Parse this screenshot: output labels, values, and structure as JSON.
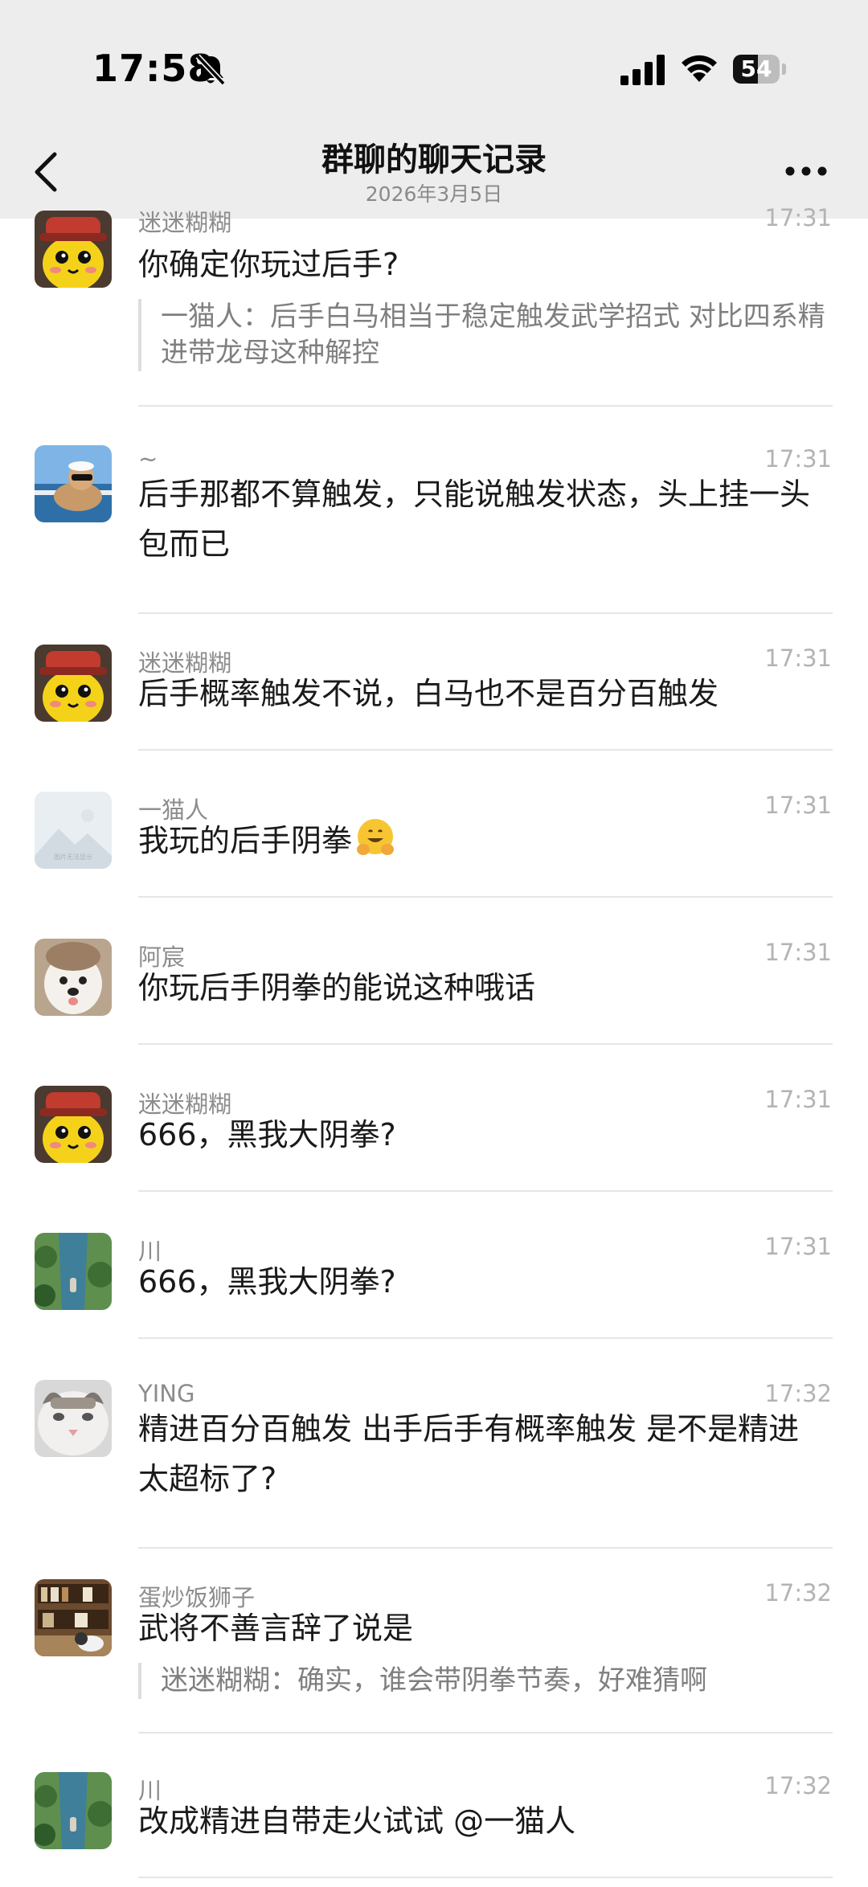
{
  "status_bar": {
    "time": "17:58",
    "battery_level": "54",
    "icons": [
      "bell-off-icon",
      "cellular-signal-icon",
      "wifi-icon",
      "battery-icon"
    ]
  },
  "nav": {
    "title": "群聊的聊天记录",
    "subtitle": "2026年3月5日",
    "back_icon": "chevron-left-icon",
    "more_icon": "more-horizontal-icon"
  },
  "messages": [
    {
      "sender": "迷迷糊糊",
      "time": "17:31",
      "text": "你确定你玩过后手?",
      "quote": "一猫人：后手白马相当于稳定触发武学招式  对比四系精进带龙母这种解控",
      "avatar": "yellow-duck-avatar"
    },
    {
      "sender": "~",
      "time": "17:31",
      "text": "后手那都不算触发，只能说触发状态，头上挂一头包而已",
      "avatar": "boat-dog-avatar"
    },
    {
      "sender": "迷迷糊糊",
      "time": "17:31",
      "text": "后手概率触发不说，白马也不是百分百触发",
      "avatar": "yellow-duck-avatar"
    },
    {
      "sender": "一猫人",
      "time": "17:31",
      "text": "我玩的后手阴拳",
      "emoji": "grinning-hands-emoji",
      "avatar": "placeholder-mountain-avatar",
      "avatar_text": "图片无法显示"
    },
    {
      "sender": "阿宸",
      "time": "17:31",
      "text": "你玩后手阴拳的能说这种哦话",
      "avatar": "fluffy-dog-avatar"
    },
    {
      "sender": "迷迷糊糊",
      "time": "17:31",
      "text": "666，黑我大阴拳?",
      "avatar": "yellow-duck-avatar"
    },
    {
      "sender": "川",
      "time": "17:31",
      "text": "666，黑我大阴拳?",
      "avatar": "river-boat-avatar"
    },
    {
      "sender": "YING",
      "time": "17:32",
      "text": "精进百分百触发  出手后手有概率触发  是不是精进太超标了?",
      "avatar": "cat-face-avatar"
    },
    {
      "sender": "蛋炒饭狮子",
      "time": "17:32",
      "text": "武将不善言辞了说是",
      "quote": "迷迷糊糊：确实，谁会带阴拳节奏，好难猜啊",
      "avatar": "bookshelf-cat-avatar"
    },
    {
      "sender": "川",
      "time": "17:32",
      "text": "改成精进自带走火试试 @一猫人",
      "avatar": "river-boat-avatar"
    }
  ]
}
